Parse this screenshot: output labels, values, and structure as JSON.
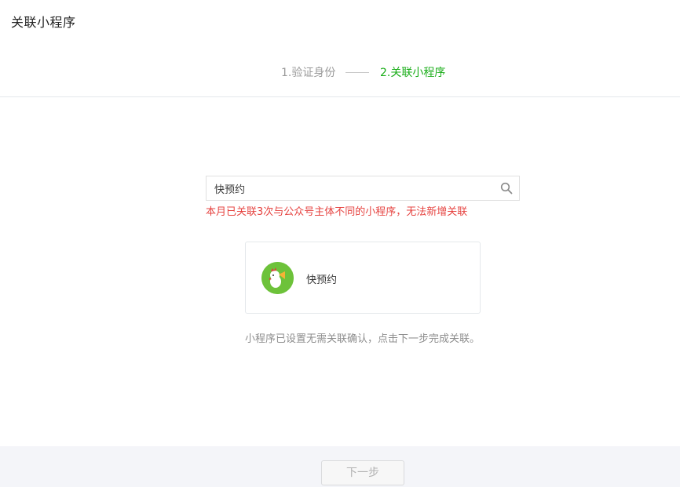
{
  "header": {
    "title": "关联小程序"
  },
  "steps": [
    {
      "label": "1.验证身份",
      "state": "done"
    },
    {
      "label": "2.关联小程序",
      "state": "active"
    }
  ],
  "search": {
    "value": "快预约",
    "icon": "search-icon"
  },
  "error": {
    "message": "本月已关联3次与公众号主体不同的小程序，无法新增关联"
  },
  "result": {
    "name": "快预约",
    "icon": "mini-program-avatar"
  },
  "hint": {
    "text": "小程序已设置无需关联确认，点击下一步完成关联。"
  },
  "footer": {
    "next_label": "下一步",
    "next_enabled": false
  },
  "colors": {
    "accent": "#1aad19",
    "error": "#e64340",
    "muted": "#9a9a9a"
  }
}
